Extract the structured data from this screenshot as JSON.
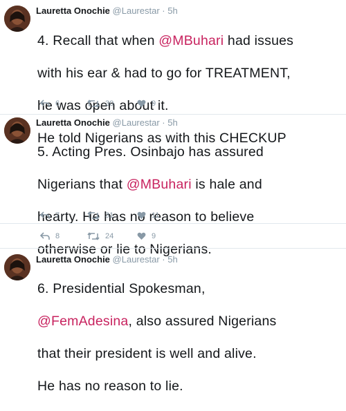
{
  "tweets": [
    {
      "author": "Lauretta Onochie",
      "handle": "@Laurestar",
      "time": "5h",
      "text_lines": [
        [
          "4. Recall that when ",
          "@MBuhari",
          " had issues"
        ],
        [
          "with his ear & had to go for TREATMENT,"
        ],
        [
          "he was open about it."
        ],
        [
          "He told Nigerians as with this CHECKUP"
        ]
      ],
      "actions": {
        "replies": "6",
        "retweets": "30",
        "likes": "9"
      }
    },
    {
      "author": "Lauretta Onochie",
      "handle": "@Laurestar",
      "time": "5h",
      "text_lines": [
        [
          "5. Acting Pres. Osinbajo has assured"
        ],
        [
          "Nigerians that ",
          "@MBuhari",
          " is hale and"
        ],
        [
          "hearty. He has no reason to believe"
        ],
        [
          "otherwise or lie to Nigerians."
        ]
      ],
      "actions": {
        "replies": "7",
        "retweets": "31",
        "likes": "11"
      },
      "actions_2": {
        "replies": "8",
        "retweets": "24",
        "likes": "9"
      }
    },
    {
      "author": "Lauretta Onochie",
      "handle": "@Laurestar",
      "time": "5h",
      "text_lines": [
        [
          "6. Presidential Spokesman,"
        ],
        [
          "@FemAdesina",
          ", also assured Nigerians"
        ],
        [
          "that their president is well and alive."
        ],
        [
          "He has no reason to lie."
        ]
      ]
    }
  ],
  "icons": {
    "reply": "reply-icon",
    "retweet": "retweet-icon",
    "like": "heart-icon"
  },
  "colors": {
    "mention": "#c8235f",
    "meta": "#8899a6",
    "divider": "#e1e8ed"
  }
}
